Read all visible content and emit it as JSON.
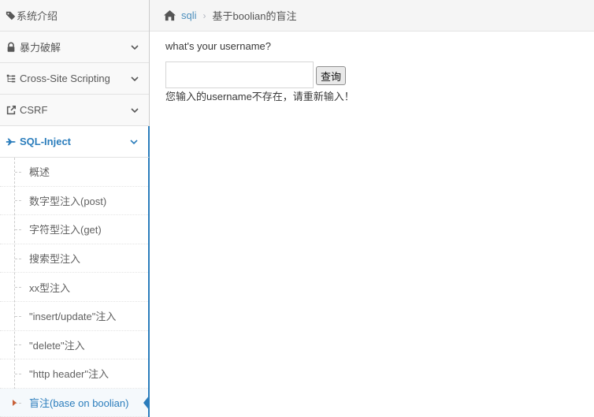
{
  "sidebar": {
    "top_item": {
      "label": "系统介绍",
      "icon": "tags-icon"
    },
    "items": [
      {
        "label": "暴力破解",
        "icon": "lock-icon"
      },
      {
        "label": "Cross-Site Scripting",
        "icon": "sitemap-icon"
      },
      {
        "label": "CSRF",
        "icon": "external-link-icon"
      },
      {
        "label": "SQL-Inject",
        "icon": "fighter-jet-icon",
        "active": true
      }
    ],
    "sub_items": [
      {
        "label": "概述"
      },
      {
        "label": "数字型注入(post)"
      },
      {
        "label": "字符型注入(get)"
      },
      {
        "label": "搜索型注入"
      },
      {
        "label": "xx型注入"
      },
      {
        "label": "\"insert/update\"注入"
      },
      {
        "label": "\"delete\"注入"
      },
      {
        "label": "\"http header\"注入"
      },
      {
        "label": "盲注(base on boolian)",
        "active": true
      }
    ]
  },
  "breadcrumb": {
    "home_icon": "home-icon",
    "link": "sqli",
    "current": "基于boolian的盲注"
  },
  "main": {
    "prompt": "what's your username?",
    "input_value": "",
    "submit_label": "查询",
    "message": "您输入的username不存在，请重新输入！"
  },
  "colors": {
    "accent": "#2b7dbc",
    "link": "#4c8fbd",
    "caret": "#c86139"
  }
}
